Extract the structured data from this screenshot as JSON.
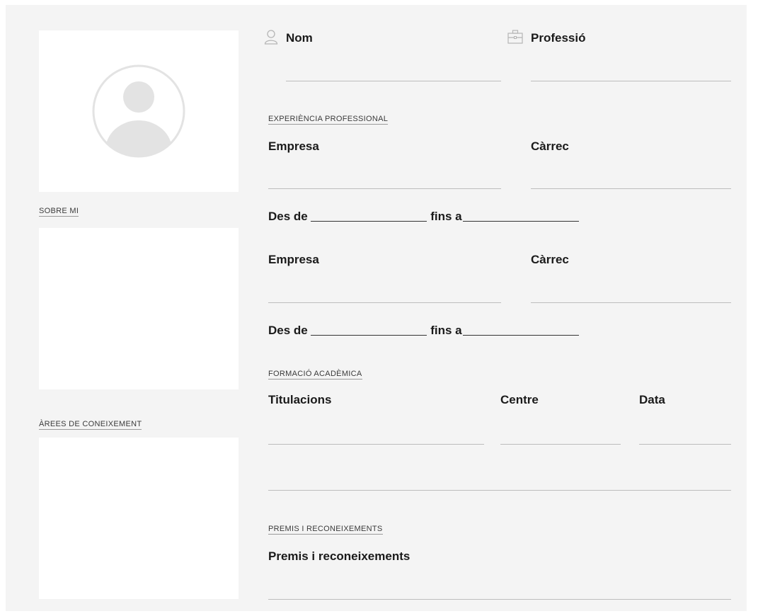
{
  "header": {
    "name_label": "Nom",
    "name_icon": "user-icon",
    "profession_label": "Professió",
    "profession_icon": "briefcase-icon"
  },
  "sidebar": {
    "avatar_icon": "avatar-placeholder-icon",
    "about_title": "SOBRE MI",
    "knowledge_title": "ÀREES DE CONEIXEMENT"
  },
  "experience": {
    "section_title": "EXPERIÈNCIA PROFESSIONAL",
    "entries": [
      {
        "company_label": "Empresa",
        "position_label": "Càrrec",
        "from_label": "Des de",
        "to_label": "fins a"
      },
      {
        "company_label": "Empresa",
        "position_label": "Càrrec",
        "from_label": "Des de",
        "to_label": "fins a"
      }
    ]
  },
  "education": {
    "section_title": "FORMACIÓ ACADÈMICA",
    "columns": [
      "Titulacions",
      "Centre",
      "Data"
    ]
  },
  "awards": {
    "section_title": "PREMIS I RECONEIXEMENTS",
    "field_label": "Premis i reconeixements"
  },
  "colors": {
    "background": "#f4f4f4",
    "box": "#ffffff",
    "avatar": "#e3e3e3",
    "rule": "#bdbdbd"
  }
}
